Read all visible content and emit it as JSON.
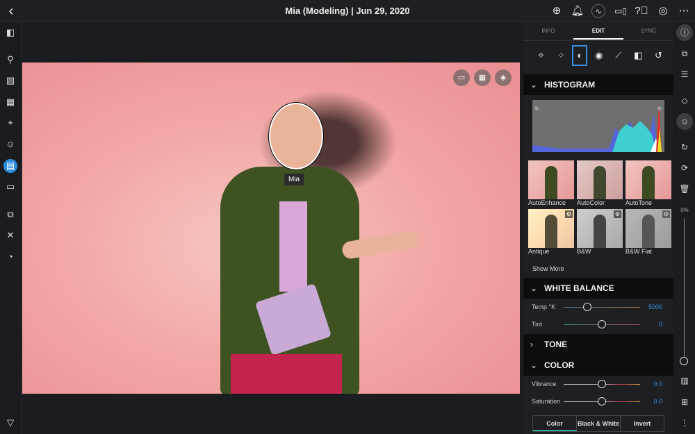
{
  "header": {
    "title": "Mia (Modeling) | Jun 29, 2020",
    "back_icon": "chevron-left-icon",
    "icons": [
      "add-circle-icon",
      "bell-icon",
      "activity-icon",
      "devices-icon",
      "help-icon",
      "account-icon",
      "more-horizontal-icon"
    ]
  },
  "left_nav": {
    "icons": [
      "panel-toggle-icon",
      "search-icon",
      "image-icon",
      "calendar-icon",
      "location-icon",
      "person-icon",
      "album-icon",
      "folder-icon",
      "duplicates-icon",
      "tools-icon",
      "speedometer-icon",
      "filter-icon"
    ]
  },
  "photo": {
    "face_label": "Mia",
    "overlay_buttons": [
      "folder-add-icon",
      "calendar-add-icon",
      "compass-icon"
    ]
  },
  "panel": {
    "tabs": [
      {
        "label": "INFO"
      },
      {
        "label": "EDIT",
        "active": true
      },
      {
        "label": "SYNC"
      }
    ],
    "tools": [
      "magic-wand-icon",
      "auto-drops-icon",
      "auto-contrast-icon",
      "eye-icon",
      "brush-icon",
      "compare-icon",
      "history-icon"
    ],
    "histogram": {
      "title": "HISTOGRAM"
    },
    "presets": [
      {
        "label": "AutoEnhance"
      },
      {
        "label": "AutoColor"
      },
      {
        "label": "AutoTone"
      },
      {
        "label": "Antique"
      },
      {
        "label": "B&W"
      },
      {
        "label": "B&W Flat"
      }
    ],
    "show_more": "Show More",
    "white_balance": {
      "title": "WHITE BALANCE",
      "temp_label": "Temp °K",
      "temp_value": "5000",
      "temp_fraction": 0.3,
      "tint_label": "Tint",
      "tint_value": "0",
      "tint_fraction": 0.5
    },
    "tone": {
      "title": "TONE"
    },
    "color": {
      "title": "COLOR",
      "vibrance_label": "Vibrance",
      "vibrance_value": "0.0",
      "vibrance_fraction": 0.5,
      "saturation_label": "Saturation",
      "saturation_value": "0.0",
      "saturation_fraction": 0.5,
      "modes": [
        "Color",
        "Black & White",
        "Invert"
      ],
      "active_mode": "Color"
    }
  },
  "right_bar": {
    "zoom_label": "0%",
    "zoom_fraction": 0
  }
}
